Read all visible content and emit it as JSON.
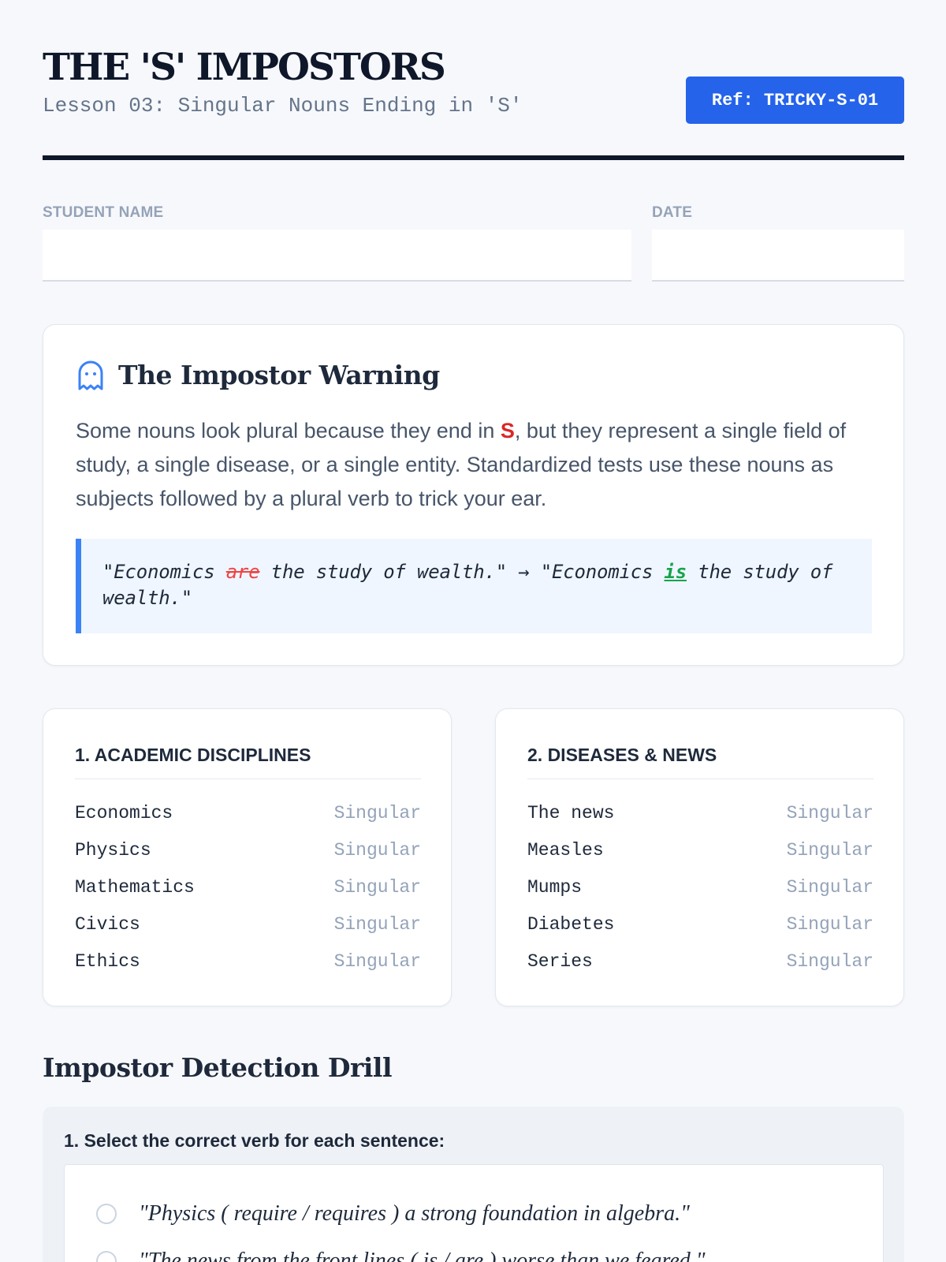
{
  "header": {
    "title": "THE 'S' IMPOSTORS",
    "subtitle": "Lesson 03: Singular Nouns Ending in 'S'",
    "ref_badge": "Ref: TRICKY-S-01"
  },
  "fields": {
    "student_name_label": "STUDENT NAME",
    "date_label": "DATE"
  },
  "warning": {
    "icon": "ghost-icon",
    "title": "The Impostor Warning",
    "text_before": "Some nouns look plural because they end in ",
    "highlight_letter": "S",
    "text_after": ", but they represent a single field of study, a single disease, or a single entity. Standardized tests use these nouns as subjects followed by a plural verb to trick your ear.",
    "example": {
      "part1": "\"Economics ",
      "wrong": "are",
      "part2": " the study of wealth.\" → \"Economics ",
      "right": "is",
      "part3": " the study of wealth.\""
    },
    "colors": {
      "highlight": "#dc2626",
      "wrong": "#ef4444",
      "right": "#16a34a",
      "accent": "#3b82f6"
    }
  },
  "categories": [
    {
      "title": "1. ACADEMIC DISCIPLINES",
      "items": [
        {
          "term": "Economics",
          "tag": "Singular"
        },
        {
          "term": "Physics",
          "tag": "Singular"
        },
        {
          "term": "Mathematics",
          "tag": "Singular"
        },
        {
          "term": "Civics",
          "tag": "Singular"
        },
        {
          "term": "Ethics",
          "tag": "Singular"
        }
      ]
    },
    {
      "title": "2. DISEASES & NEWS",
      "items": [
        {
          "term": "The news",
          "tag": "Singular"
        },
        {
          "term": "Measles",
          "tag": "Singular"
        },
        {
          "term": "Mumps",
          "tag": "Singular"
        },
        {
          "term": "Diabetes",
          "tag": "Singular"
        },
        {
          "term": "Series",
          "tag": "Singular"
        }
      ]
    }
  ],
  "drill": {
    "title": "Impostor Detection Drill",
    "question": "1. Select the correct verb for each sentence:",
    "items": [
      "\"Physics ( require / requires ) a strong foundation in algebra.\"",
      "\"The news from the front lines ( is / are ) worse than we feared.\""
    ]
  }
}
